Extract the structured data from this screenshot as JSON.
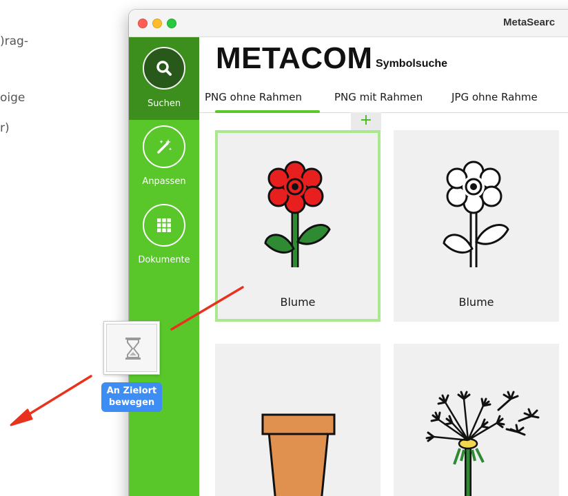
{
  "background_doc": {
    "line1": ")rag-",
    "line2": "oige",
    "line3": "r)"
  },
  "window": {
    "title": "MetaSearc"
  },
  "sidebar": {
    "items": [
      {
        "label": "Suchen",
        "icon": "search-icon",
        "active": true
      },
      {
        "label": "Anpassen",
        "icon": "magic-wand-icon",
        "active": false
      },
      {
        "label": "Dokumente",
        "icon": "grid-icon",
        "active": false
      }
    ]
  },
  "header": {
    "brand": "METACOM",
    "subtitle": "Symbolsuche"
  },
  "tabs": [
    {
      "label": "PNG ohne Rahmen",
      "selected": true
    },
    {
      "label": "PNG mit Rahmen",
      "selected": false
    },
    {
      "label": "JPG ohne Rahme",
      "selected": false
    }
  ],
  "grid": {
    "add_button": "+",
    "cards": [
      {
        "label": "Blume",
        "image": "red-flower-icon",
        "selected": true
      },
      {
        "label": "Blume",
        "image": "outline-flower-icon",
        "selected": false
      },
      {
        "label": "",
        "image": "flower-pot-icon",
        "selected": false
      },
      {
        "label": "",
        "image": "dandelion-icon",
        "selected": false
      }
    ]
  },
  "drag": {
    "badge_line1": "An Zielort",
    "badge_line2": "bewegen",
    "thumb_icon": "hourglass-icon"
  },
  "colors": {
    "sidebar_green": "#59c72a",
    "sidebar_active": "#3c8f1d",
    "selection_border": "#a9e88d",
    "badge_blue": "#3d8df5",
    "arrow_red": "#e8321e"
  }
}
